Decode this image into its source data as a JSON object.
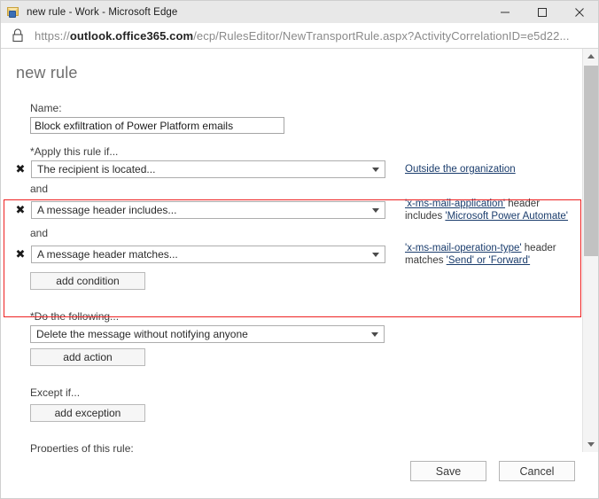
{
  "window": {
    "title": "new rule - Work - Microsoft Edge",
    "favicon": "mail-envelope-icon",
    "minimize_label": "Minimize",
    "maximize_label": "Maximize",
    "close_label": "Close"
  },
  "address_bar": {
    "lock_icon": "lock-icon",
    "url_scheme": "https://",
    "url_host": "outlook.office365.com",
    "url_path": "/ecp/RulesEditor/NewTransportRule.aspx?ActivityCorrelationID=e5d22..."
  },
  "page": {
    "title": "new rule",
    "name_label": "Name:",
    "name_value": "Block exfiltration of Power Platform emails",
    "name_placeholder": "",
    "apply_label": "*Apply this rule if...",
    "and_label": "and",
    "conditions": [
      {
        "remove_label": "✖",
        "selected": "The recipient is located...",
        "description_html": "<a href=\"#\">Outside the organization</a>",
        "single_line": true
      },
      {
        "remove_label": "✖",
        "selected": "A message header includes...",
        "description_html": "<a href=\"#\">'x-ms-mail-application'</a> header includes <a href=\"#\">'Microsoft Power Automate'</a>",
        "single_line": false
      },
      {
        "remove_label": "✖",
        "selected": "A message header matches...",
        "description_html": "<a href=\"#\">'x-ms-mail-operation-type'</a> header matches <a href=\"#\">'Send' or 'Forward'</a>",
        "single_line": false
      }
    ],
    "add_condition_label": "add condition",
    "do_following_label": "*Do the following...",
    "action_selected": "Delete the message without notifying anyone",
    "add_action_label": "add action",
    "except_label": "Except if...",
    "add_exception_label": "add exception",
    "properties_label": "Properties of this rule:"
  },
  "footer": {
    "save_label": "Save",
    "cancel_label": "Cancel"
  },
  "scrollbar": {
    "up_arrow": "scroll-up-icon",
    "down_arrow": "scroll-down-icon"
  },
  "colors": {
    "highlight": "#ee2222",
    "link": "#1b3d6d",
    "title_text": "#6e6e6e"
  }
}
